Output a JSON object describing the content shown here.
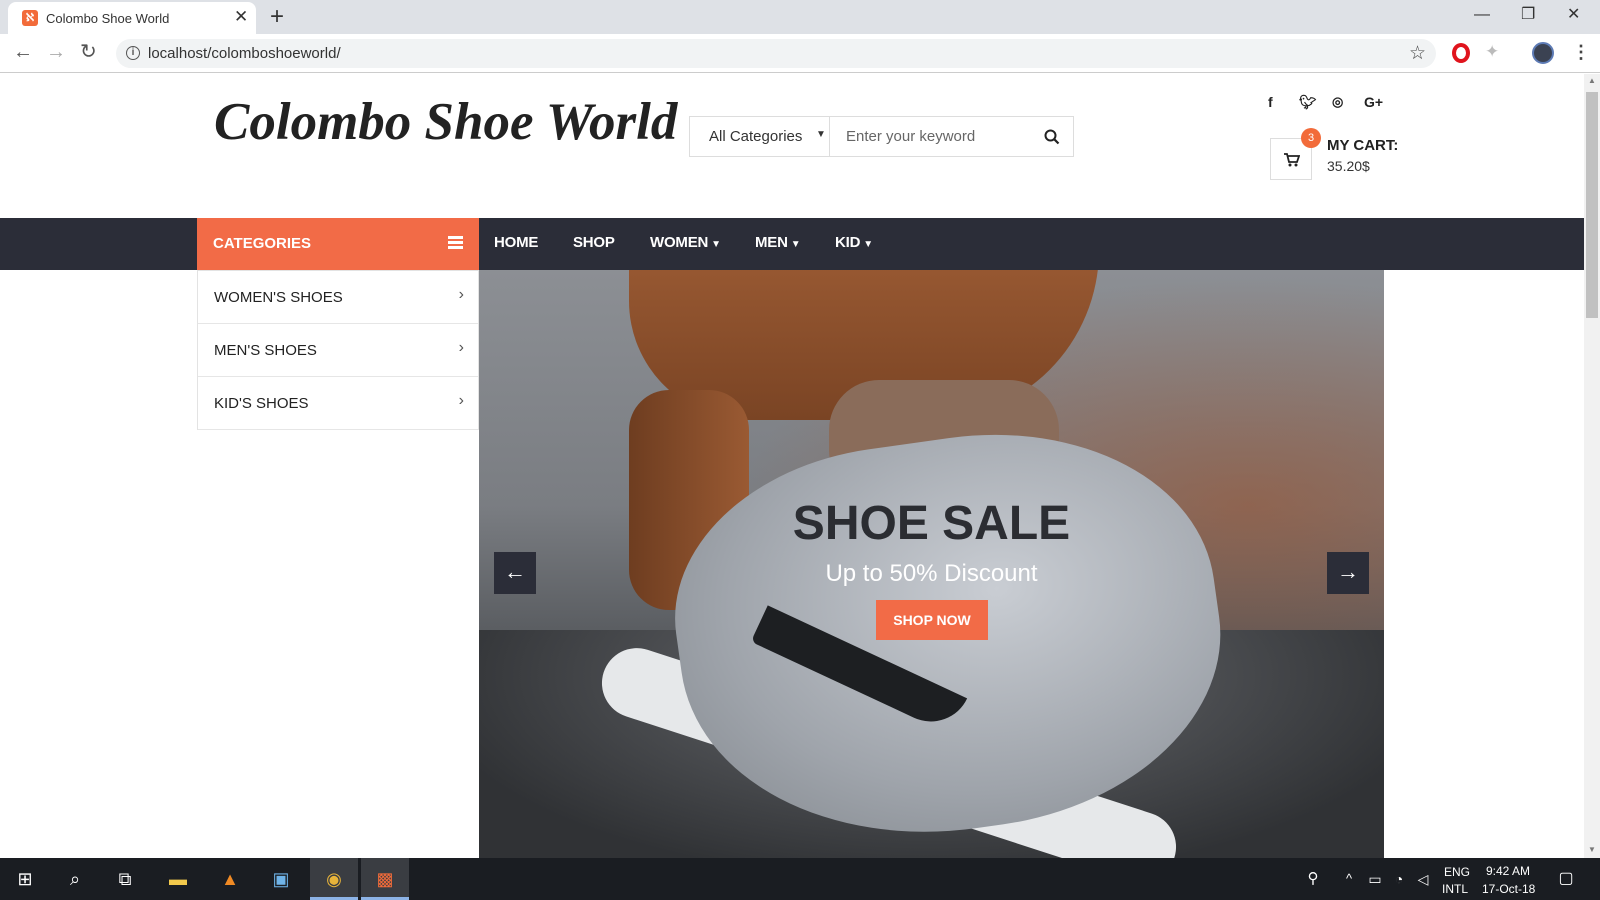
{
  "browser": {
    "tab_title": "Colombo Shoe World",
    "favicon": "xampp-icon",
    "url": "localhost/colomboshoeworld/",
    "nav_icons": [
      "back-arrow-icon",
      "forward-arrow-icon",
      "reload-icon"
    ],
    "window_controls": [
      "minimize-icon",
      "restore-icon",
      "close-icon"
    ]
  },
  "site": {
    "logo": "Colombo Shoe World",
    "search": {
      "category": "All Categories",
      "placeholder": "Enter your keyword"
    },
    "social": [
      "facebook-icon",
      "twitter-icon",
      "instagram-icon",
      "google-plus-icon"
    ],
    "cart": {
      "count": "3",
      "label": "MY CART:",
      "amount": "35.20$"
    },
    "nav": {
      "categories_label": "CATEGORIES",
      "items": [
        {
          "label": "HOME"
        },
        {
          "label": "SHOP"
        },
        {
          "label": "WOMEN"
        },
        {
          "label": "MEN"
        },
        {
          "label": "KID"
        }
      ]
    },
    "categories": [
      {
        "label": "WOMEN'S SHOES"
      },
      {
        "label": "MEN'S SHOES"
      },
      {
        "label": "KID'S SHOES"
      }
    ],
    "hero": {
      "title": "SHOE SALE",
      "subtitle": "Up to 50% Discount",
      "button": "SHOP NOW"
    }
  },
  "taskbar": {
    "apps": [
      "windows-start-icon",
      "search-icon",
      "task-view-icon",
      "file-explorer-icon",
      "vlc-icon",
      "control-panel-icon",
      "chrome-icon",
      "xampp-icon"
    ],
    "lang_top": "ENG",
    "lang_bottom": "INTL",
    "time": "9:42 AM",
    "date": "17-Oct-18"
  },
  "colors": {
    "accent": "#f26b47",
    "navbar": "#2b2d38"
  }
}
